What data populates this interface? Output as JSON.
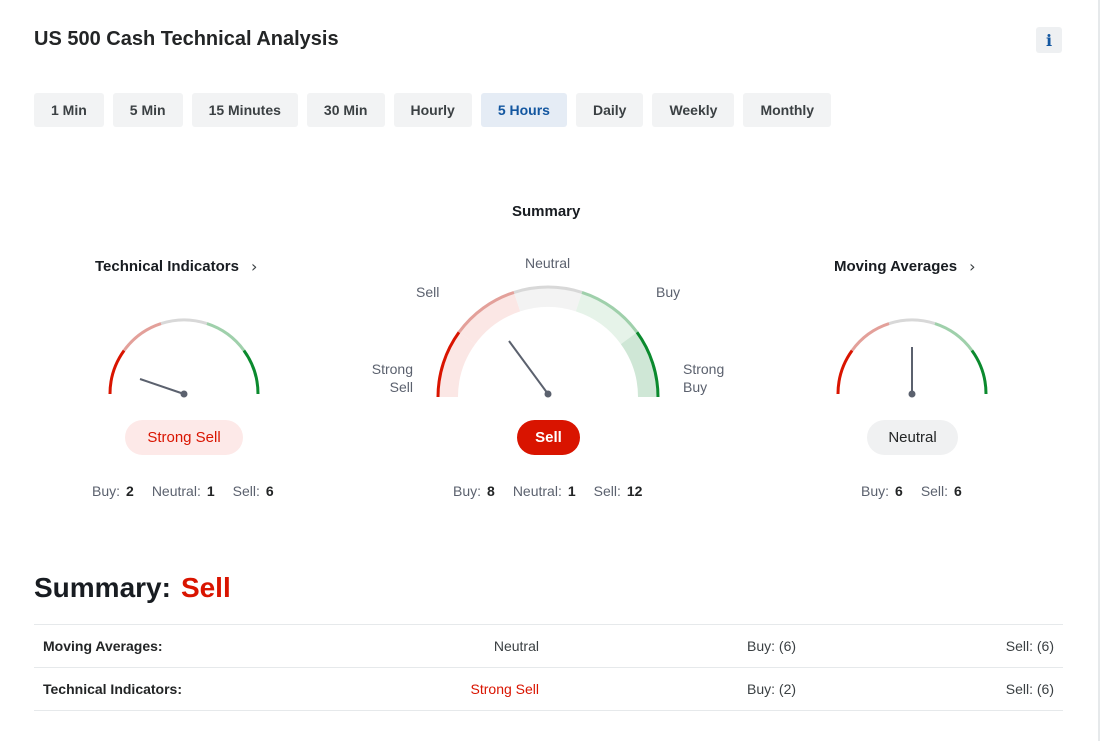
{
  "header": {
    "title": "US 500 Cash Technical Analysis",
    "info_icon": "info-icon"
  },
  "tabs": [
    {
      "label": "1 Min"
    },
    {
      "label": "5 Min"
    },
    {
      "label": "15 Minutes"
    },
    {
      "label": "30 Min"
    },
    {
      "label": "Hourly"
    },
    {
      "label": "5 Hours",
      "active": true
    },
    {
      "label": "Daily"
    },
    {
      "label": "Weekly"
    },
    {
      "label": "Monthly"
    }
  ],
  "gauges": {
    "technical": {
      "title": "Technical Indicators",
      "signal": "Strong Sell",
      "buy_label": "Buy:",
      "buy": "2",
      "neutral_label": "Neutral:",
      "neutral": "1",
      "sell_label": "Sell:",
      "sell": "6"
    },
    "summary": {
      "title": "Summary",
      "signal": "Sell",
      "labels": {
        "strong_sell": [
          "Strong",
          "Sell"
        ],
        "sell": "Sell",
        "neutral": "Neutral",
        "buy": "Buy",
        "strong_buy": [
          "Strong",
          "Buy"
        ]
      },
      "buy_label": "Buy:",
      "buy": "8",
      "neutral_label": "Neutral:",
      "neutral": "1",
      "sell_label": "Sell:",
      "sell": "12"
    },
    "moving": {
      "title": "Moving Averages",
      "signal": "Neutral",
      "buy_label": "Buy:",
      "buy": "6",
      "sell_label": "Sell:",
      "sell": "6"
    }
  },
  "summary": {
    "label": "Summary:",
    "value": "Sell",
    "rows": [
      {
        "name": "Moving Averages:",
        "value": "Neutral",
        "buy": "Buy: (6)",
        "sell": "Sell: (6)"
      },
      {
        "name": "Technical Indicators:",
        "value": "Strong Sell",
        "buy": "Buy: (2)",
        "sell": "Sell: (6)"
      }
    ]
  },
  "colors": {
    "sell_red": "#d91400",
    "buy_green": "#0b8a2e",
    "active_tab_bg": "#e5ecf5",
    "active_tab_text": "#1256a0"
  }
}
